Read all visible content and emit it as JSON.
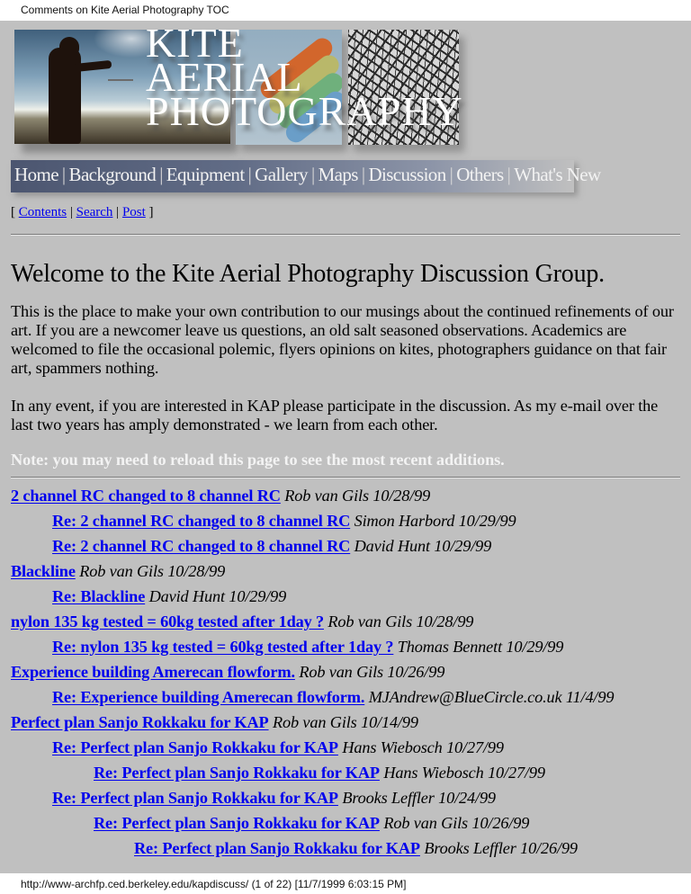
{
  "document": {
    "print_header": "Comments on Kite Aerial Photography TOC",
    "print_footer": "http://www-archfp.ced.berkeley.edu/kapdiscuss/ (1 of 22) [11/7/1999 6:03:15 PM]"
  },
  "banner": {
    "title_lines": [
      "KITE",
      "AERIAL",
      "PHOTOGRAPHY"
    ],
    "nav": [
      {
        "label": "Home"
      },
      {
        "label": "Background"
      },
      {
        "label": "Equipment"
      },
      {
        "label": "Gallery"
      },
      {
        "label": "Maps"
      },
      {
        "label": "Discussion"
      },
      {
        "label": "Others"
      },
      {
        "label": "What's New"
      }
    ],
    "separator": "|"
  },
  "linkbar": {
    "open": "[",
    "close": "]",
    "sep": "|",
    "links": [
      {
        "label": "Contents"
      },
      {
        "label": "Search"
      },
      {
        "label": "Post"
      }
    ]
  },
  "main": {
    "heading": "Welcome to the Kite Aerial Photography Discussion Group.",
    "intro_1": "This is the place to make your own contribution to our musings about the continued refinements of our art. If you are a newcomer leave us questions, an old salt seasoned observations. Academics are welcomed to file the occasional polemic, flyers opinions on kites, photographers guidance on that fair art, spammers nothing.",
    "intro_2": "In any event, if you are interested in KAP please participate in the discussion. As my e-mail over the last two years has amply demonstrated - we learn from each other.",
    "note": "Note: you may need to reload this page to see the most recent additions."
  },
  "threads": [
    {
      "level": 0,
      "title": "2 channel RC changed to 8 channel RC",
      "author": "Rob van Gils",
      "date": "10/28/99"
    },
    {
      "level": 1,
      "title": "Re: 2 channel RC changed to 8 channel RC",
      "author": "Simon Harbord",
      "date": "10/29/99"
    },
    {
      "level": 1,
      "title": "Re: 2 channel RC changed to 8 channel RC",
      "author": "David Hunt",
      "date": "10/29/99"
    },
    {
      "level": 0,
      "title": "Blackline",
      "author": "Rob van Gils",
      "date": "10/28/99"
    },
    {
      "level": 1,
      "title": "Re: Blackline",
      "author": "David Hunt",
      "date": "10/29/99"
    },
    {
      "level": 0,
      "title": "nylon 135 kg tested = 60kg tested after 1day ?",
      "author": "Rob van Gils",
      "date": "10/28/99"
    },
    {
      "level": 1,
      "title": "Re: nylon 135 kg tested = 60kg tested after 1day ?",
      "author": "Thomas Bennett",
      "date": "10/29/99"
    },
    {
      "level": 0,
      "title": "Experience building Amerecan flowform.",
      "author": "Rob van Gils",
      "date": "10/26/99"
    },
    {
      "level": 1,
      "title": "Re: Experience building Amerecan flowform.",
      "author": "MJAndrew@BlueCircle.co.uk",
      "date": "11/4/99"
    },
    {
      "level": 0,
      "title": "Perfect plan Sanjo Rokkaku for KAP",
      "author": "Rob van Gils",
      "date": "10/14/99"
    },
    {
      "level": 1,
      "title": "Re: Perfect plan Sanjo Rokkaku for KAP",
      "author": "Hans Wiebosch",
      "date": "10/27/99"
    },
    {
      "level": 2,
      "title": "Re: Perfect plan Sanjo Rokkaku for KAP",
      "author": "Hans Wiebosch",
      "date": "10/27/99"
    },
    {
      "level": 1,
      "title": "Re: Perfect plan Sanjo Rokkaku for KAP",
      "author": "Brooks Leffler",
      "date": "10/24/99"
    },
    {
      "level": 2,
      "title": "Re: Perfect plan Sanjo Rokkaku for KAP",
      "author": "Rob van Gils",
      "date": "10/26/99"
    },
    {
      "level": 3,
      "title": "Re: Perfect plan Sanjo Rokkaku for KAP",
      "author": "Brooks Leffler",
      "date": "10/26/99"
    }
  ],
  "colors": {
    "page_background": "#c0c0c0",
    "link": "#0000ee",
    "note_text": "#f3f3f3"
  }
}
